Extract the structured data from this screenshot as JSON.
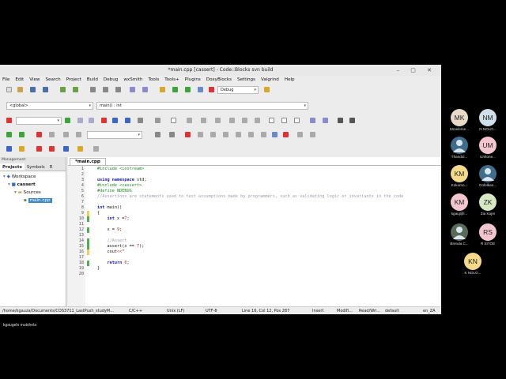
{
  "window": {
    "title": "*main.cpp [cassert] - Code::Blocks svn build",
    "controls": "– ▢ ✕"
  },
  "menu": [
    "File",
    "Edit",
    "View",
    "Search",
    "Project",
    "Build",
    "Debug",
    "wxSmith",
    "Tools",
    "Tools+",
    "Plugins",
    "DoxyBlocks",
    "Settings",
    "Valgrind",
    "Help"
  ],
  "toolbar": {
    "build_target": "Debug",
    "scope": "<global>",
    "function": "main() : int"
  },
  "management": {
    "title": "Management",
    "tabs": [
      "Projects",
      "Symbols",
      "R"
    ],
    "tree": {
      "workspace": "Workspace",
      "project": "cassert",
      "folder": "Sources",
      "file": "main.cpp"
    }
  },
  "editor": {
    "tab": "*main.cpp",
    "lines": [
      {
        "n": "1",
        "parts": [
          {
            "c": "pp",
            "t": "#include <iostream>"
          }
        ]
      },
      {
        "n": "2",
        "parts": []
      },
      {
        "n": "3",
        "parts": [
          {
            "c": "kw",
            "t": "using namespace"
          },
          {
            "c": "tx",
            "t": " std;"
          }
        ]
      },
      {
        "n": "4",
        "parts": [
          {
            "c": "pp",
            "t": "#include <cassert>"
          }
        ]
      },
      {
        "n": "5",
        "parts": [
          {
            "c": "pp",
            "t": "#define NDEBUG"
          }
        ]
      },
      {
        "n": "6",
        "parts": [
          {
            "c": "cm",
            "t": "//Assertions are statements used to test assumptions made by programmers, such as validating logic or invariants in the code"
          }
        ]
      },
      {
        "n": "7",
        "parts": []
      },
      {
        "n": "8",
        "parts": [
          {
            "c": "kw",
            "t": "int"
          },
          {
            "c": "tx",
            "t": " main()"
          }
        ]
      },
      {
        "n": "9",
        "parts": [
          {
            "c": "tx",
            "t": "{"
          }
        ]
      },
      {
        "n": "10",
        "parts": [
          {
            "c": "tx",
            "t": "    "
          },
          {
            "c": "kw",
            "t": "int"
          },
          {
            "c": "tx",
            "t": " x ="
          },
          {
            "c": "nm",
            "t": "7"
          },
          {
            "c": "tx",
            "t": ";"
          }
        ]
      },
      {
        "n": "11",
        "parts": []
      },
      {
        "n": "12",
        "parts": [
          {
            "c": "tx",
            "t": "    x = "
          },
          {
            "c": "nm",
            "t": "9"
          },
          {
            "c": "tx",
            "t": ";"
          }
        ]
      },
      {
        "n": "13",
        "parts": []
      },
      {
        "n": "14",
        "parts": [
          {
            "c": "cm",
            "t": "    //Assert"
          }
        ]
      },
      {
        "n": "15",
        "parts": [
          {
            "c": "tx",
            "t": "    assert(x == "
          },
          {
            "c": "nm",
            "t": "7"
          },
          {
            "c": "tx",
            "t": ");"
          }
        ]
      },
      {
        "n": "16",
        "parts": [
          {
            "c": "tx",
            "t": "    cout"
          },
          {
            "c": "op",
            "t": "<<"
          },
          {
            "c": "tx",
            "t": "\""
          }
        ]
      },
      {
        "n": "17",
        "parts": []
      },
      {
        "n": "18",
        "parts": [
          {
            "c": "tx",
            "t": "    "
          },
          {
            "c": "kw",
            "t": "return"
          },
          {
            "c": "tx",
            "t": " "
          },
          {
            "c": "nm",
            "t": "0"
          },
          {
            "c": "tx",
            "t": ";"
          }
        ]
      },
      {
        "n": "19",
        "parts": [
          {
            "c": "tx",
            "t": "}"
          }
        ]
      },
      {
        "n": "20",
        "parts": []
      }
    ]
  },
  "status": {
    "path": "/home/kgauza/Documents/COS3711_LastPush_studyM...",
    "language": "C/C++",
    "eol": "Unix (LF)",
    "encoding": "UTF-8",
    "position": "Line 16, Col 12, Pos 287",
    "mode": "Insert",
    "modified": "Modifi...",
    "access": "Read/Wri...",
    "profile": "default",
    "locale": "en_ZA"
  },
  "participants": [
    {
      "initials": "MK",
      "name": "Mmeleme...",
      "color": "#e8d9c8",
      "photo": false
    },
    {
      "initials": "NM",
      "name": "N NOLO...",
      "color": "#cfe0ea",
      "photo": false
    },
    {
      "initials": "",
      "name": "Thandol...",
      "color": "#3d6d8a",
      "photo": true
    },
    {
      "initials": "UM",
      "name": "Unhone...",
      "color": "#f3c6cf",
      "photo": false
    },
    {
      "initials": "KM",
      "name": "Kokomo...",
      "color": "#f5d98a",
      "photo": false
    },
    {
      "initials": "",
      "name": "Gofelkan...",
      "color": "#3d6d8a",
      "photo": true
    },
    {
      "initials": "KM",
      "name": "kgauj@l...",
      "color": "#f3c6cf",
      "photo": false
    },
    {
      "initials": "ZK",
      "name": "Zia Kajre",
      "color": "#d7e8c5",
      "photo": false
    },
    {
      "initials": "",
      "name": "Brenda C...",
      "color": "#5a6a5a",
      "photo": true
    },
    {
      "initials": "RS",
      "name": "R SITOE",
      "color": "#f3c6cf",
      "photo": false
    },
    {
      "initials": "KN",
      "name": "K NDLO...",
      "color": "#f5d98a",
      "photo": false
    }
  ],
  "host": {
    "name": "kgaugelo mutshela"
  }
}
